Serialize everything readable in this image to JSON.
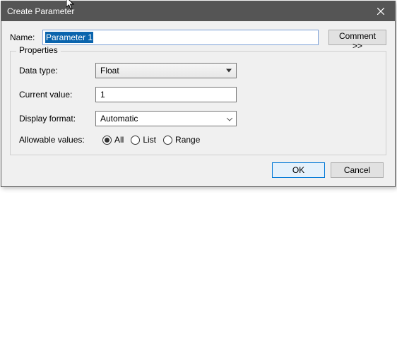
{
  "titlebar": {
    "title": "Create Parameter"
  },
  "name_row": {
    "label": "Name:",
    "value": "Parameter 1",
    "comment_button": "Comment >>"
  },
  "properties": {
    "legend": "Properties",
    "data_type": {
      "label": "Data type:",
      "value": "Float"
    },
    "current_value": {
      "label": "Current value:",
      "value": "1"
    },
    "display_format": {
      "label": "Display format:",
      "value": "Automatic"
    },
    "allowable": {
      "label": "Allowable values:",
      "options": {
        "all": "All",
        "list": "List",
        "range": "Range"
      },
      "selected": "all"
    }
  },
  "footer": {
    "ok": "OK",
    "cancel": "Cancel"
  }
}
